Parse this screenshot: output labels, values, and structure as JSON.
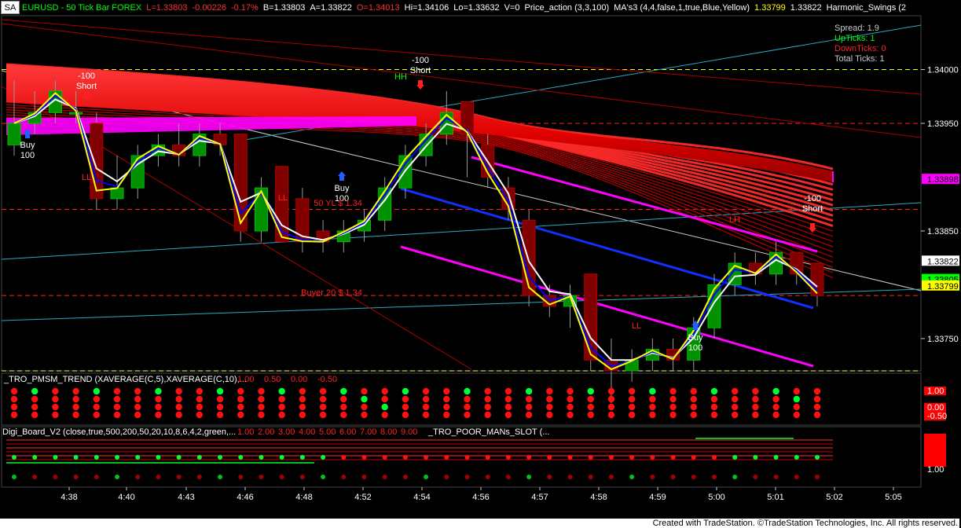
{
  "window": {
    "symbol_badge": "SA",
    "title_parts": [
      {
        "text": "EURUSD - 50 Tick Bar  FOREX",
        "color": "#00ff00"
      },
      {
        "text": "L=1.33803",
        "color": "#ff3030"
      },
      {
        "text": "-0.00226",
        "color": "#ff3030"
      },
      {
        "text": "-0.17%",
        "color": "#ff3030"
      },
      {
        "text": "B=1.33803",
        "color": "#ffffff"
      },
      {
        "text": "A=1.33822",
        "color": "#ffffff"
      },
      {
        "text": "O=1.34013",
        "color": "#ff3030"
      },
      {
        "text": "Hi=1.34106",
        "color": "#ffffff"
      },
      {
        "text": "Lo=1.33632",
        "color": "#ffffff"
      },
      {
        "text": "V=0",
        "color": "#ffffff"
      },
      {
        "text": "Price_action (3,3,100)",
        "color": "#ffffff"
      },
      {
        "text": "MA's3 (4,4,false,1,true,Blue,Yellow)",
        "color": "#ffffff"
      },
      {
        "text": "1.33799",
        "color": "#ffff00"
      },
      {
        "text": "1.33822",
        "color": "#ffffff"
      },
      {
        "text": "Harmonic_Swings (2",
        "color": "#ffffff"
      }
    ],
    "footer": "Created with TradeStation. ©TradeStation Technologies, Inc. All rights reserved."
  },
  "stats_box": [
    {
      "text": "Spread: 1.9",
      "color": "#cccccc"
    },
    {
      "text": "UpTicks: 1",
      "color": "#00ff00"
    },
    {
      "text": "DownTicks: 0",
      "color": "#ff2020"
    },
    {
      "text": "Total Ticks: 1",
      "color": "#cccccc"
    }
  ],
  "annotations": [
    {
      "id": "short1",
      "lines": [
        "-100",
        "Short"
      ],
      "color": "#ffffff"
    },
    {
      "id": "short2",
      "lines": [
        "-100",
        "Short"
      ],
      "color": "#ffffff"
    },
    {
      "id": "short3",
      "lines": [
        "-100",
        "Short"
      ],
      "color": "#ffffff"
    },
    {
      "id": "buy1",
      "lines": [
        "Buy",
        "100"
      ],
      "color": "#ffffff"
    },
    {
      "id": "buy2",
      "lines": [
        "Buy",
        "100"
      ],
      "color": "#ffffff"
    },
    {
      "id": "buy3",
      "lines": [
        "Buy",
        "100"
      ],
      "color": "#ffffff"
    },
    {
      "id": "hh",
      "lines": [
        "HH"
      ],
      "color": "#00ff00"
    },
    {
      "id": "ll1",
      "lines": [
        "LL"
      ],
      "color": "#ff2020"
    },
    {
      "id": "ll2",
      "lines": [
        "LL"
      ],
      "color": "#ff2020"
    },
    {
      "id": "ll3",
      "lines": [
        "LL"
      ],
      "color": "#ff2020"
    },
    {
      "id": "lh",
      "lines": [
        "LH"
      ],
      "color": "#ff2020"
    },
    {
      "id": "level50",
      "lines": [
        "50 YL $ 1.34"
      ],
      "color": "#ff2020"
    },
    {
      "id": "buyer20",
      "lines": [
        "Buyer 20 $ 1.34"
      ],
      "color": "#ff2020"
    }
  ],
  "price_axis": {
    "ticks": [
      "1.34000",
      "1.33950",
      "1.33850",
      "1.33750"
    ],
    "markers": [
      {
        "text": "1.33898",
        "bg": "#ff00ff",
        "fg": "#000000"
      },
      {
        "text": "1.33822",
        "bg": "#ffffff",
        "fg": "#000000"
      },
      {
        "text": "1.33805",
        "bg": "#00ff00",
        "fg": "#000000"
      },
      {
        "text": "1.33799",
        "bg": "#ffff00",
        "fg": "#000000"
      }
    ]
  },
  "chart_data": {
    "type": "candlestick",
    "title": "EURUSD - 50 Tick Bar FOREX",
    "x_tick_labels": [
      "4:38",
      "4:40",
      "4:43",
      "4:46",
      "4:48",
      "4:52",
      "4:54",
      "4:56",
      "4:57",
      "4:58",
      "4:59",
      "5:00",
      "5:01",
      "5:02",
      "5:05"
    ],
    "ylim": [
      1.3372,
      1.3405
    ],
    "y_ticks": [
      1.34,
      1.3395,
      1.3385,
      1.3375
    ],
    "candles": [
      {
        "o": 1.3393,
        "h": 1.3399,
        "l": 1.3392,
        "c": 1.3395
      },
      {
        "o": 1.3395,
        "h": 1.3398,
        "l": 1.3394,
        "c": 1.3396
      },
      {
        "o": 1.3396,
        "h": 1.3399,
        "l": 1.3395,
        "c": 1.3398
      },
      {
        "o": 1.3396,
        "h": 1.3398,
        "l": 1.3395,
        "c": 1.3396
      },
      {
        "o": 1.3395,
        "h": 1.3396,
        "l": 1.3387,
        "c": 1.3388
      },
      {
        "o": 1.3388,
        "h": 1.3392,
        "l": 1.3387,
        "c": 1.3389
      },
      {
        "o": 1.3389,
        "h": 1.3393,
        "l": 1.3388,
        "c": 1.3392
      },
      {
        "o": 1.3392,
        "h": 1.3394,
        "l": 1.3391,
        "c": 1.3393
      },
      {
        "o": 1.3393,
        "h": 1.3395,
        "l": 1.3391,
        "c": 1.3392
      },
      {
        "o": 1.3392,
        "h": 1.3395,
        "l": 1.3391,
        "c": 1.3394
      },
      {
        "o": 1.3394,
        "h": 1.3395,
        "l": 1.3392,
        "c": 1.3393
      },
      {
        "o": 1.3394,
        "h": 1.3394,
        "l": 1.3384,
        "c": 1.3385
      },
      {
        "o": 1.3385,
        "h": 1.339,
        "l": 1.3384,
        "c": 1.3389
      },
      {
        "o": 1.3391,
        "h": 1.3391,
        "l": 1.3384,
        "c": 1.3384
      },
      {
        "o": 1.3388,
        "h": 1.3389,
        "l": 1.3383,
        "c": 1.3384
      },
      {
        "o": 1.3385,
        "h": 1.3386,
        "l": 1.3383,
        "c": 1.3384
      },
      {
        "o": 1.3384,
        "h": 1.3386,
        "l": 1.3383,
        "c": 1.3385
      },
      {
        "o": 1.3385,
        "h": 1.3387,
        "l": 1.3384,
        "c": 1.3386
      },
      {
        "o": 1.3386,
        "h": 1.339,
        "l": 1.3385,
        "c": 1.3389
      },
      {
        "o": 1.3389,
        "h": 1.3393,
        "l": 1.3388,
        "c": 1.3392
      },
      {
        "o": 1.3392,
        "h": 1.3395,
        "l": 1.3391,
        "c": 1.3394
      },
      {
        "o": 1.3394,
        "h": 1.3398,
        "l": 1.3393,
        "c": 1.3396
      },
      {
        "o": 1.3397,
        "h": 1.3397,
        "l": 1.339,
        "c": 1.3394
      },
      {
        "o": 1.3393,
        "h": 1.3394,
        "l": 1.3389,
        "c": 1.339
      },
      {
        "o": 1.3389,
        "h": 1.339,
        "l": 1.3386,
        "c": 1.3387
      },
      {
        "o": 1.3386,
        "h": 1.3387,
        "l": 1.3378,
        "c": 1.3379
      },
      {
        "o": 1.3379,
        "h": 1.338,
        "l": 1.3377,
        "c": 1.3378
      },
      {
        "o": 1.3378,
        "h": 1.338,
        "l": 1.3376,
        "c": 1.3379
      },
      {
        "o": 1.3381,
        "h": 1.3381,
        "l": 1.3372,
        "c": 1.3373
      },
      {
        "o": 1.3373,
        "h": 1.3375,
        "l": 1.3369,
        "c": 1.3372
      },
      {
        "o": 1.3372,
        "h": 1.3374,
        "l": 1.3371,
        "c": 1.3373
      },
      {
        "o": 1.3373,
        "h": 1.3375,
        "l": 1.3372,
        "c": 1.3374
      },
      {
        "o": 1.3374,
        "h": 1.3375,
        "l": 1.3372,
        "c": 1.3373
      },
      {
        "o": 1.3373,
        "h": 1.3377,
        "l": 1.3372,
        "c": 1.3376
      },
      {
        "o": 1.3376,
        "h": 1.3381,
        "l": 1.3375,
        "c": 1.338
      },
      {
        "o": 1.338,
        "h": 1.3383,
        "l": 1.3379,
        "c": 1.3382
      },
      {
        "o": 1.3382,
        "h": 1.3383,
        "l": 1.338,
        "c": 1.3381
      },
      {
        "o": 1.3381,
        "h": 1.3384,
        "l": 1.338,
        "c": 1.3383
      },
      {
        "o": 1.3383,
        "h": 1.3383,
        "l": 1.338,
        "c": 1.3381
      },
      {
        "o": 1.3382,
        "h": 1.3382,
        "l": 1.3378,
        "c": 1.3379
      }
    ],
    "series": [
      {
        "name": "MA's3",
        "color": "#ffffff"
      },
      {
        "name": "MA's3",
        "color": "#0000ff"
      },
      {
        "name": "MA's3",
        "color": "#ffff00"
      }
    ]
  },
  "indicators": {
    "panel1": {
      "label": "_TRO_PMSM_TREND (XAVERAGE(C,5),XAVERAGE(C,10),...",
      "values": [
        {
          "text": "1.00",
          "color": "#ff2020"
        },
        {
          "text": "0.50",
          "color": "#ff2020"
        },
        {
          "text": "0.00",
          "color": "#ff2020"
        },
        {
          "text": "-0.50",
          "color": "#ff2020"
        }
      ],
      "axis": [
        {
          "text": "1.00",
          "bg": "#ff0000",
          "fg": "#ffffff"
        },
        {
          "text": "0.00",
          "bg": "#ff0000",
          "fg": "#ffffff"
        },
        {
          "text": "-0.50",
          "bg": "#ff0000",
          "fg": "#ffffff"
        }
      ]
    },
    "panel2": {
      "label": "Digi_Board_V2 (close,true,500,200,50,20,10,8,6,4,2,green,...",
      "values": [
        {
          "text": "1.00",
          "color": "#ff2020"
        },
        {
          "text": "2.00",
          "color": "#ff2020"
        },
        {
          "text": "3.00",
          "color": "#ff2020"
        },
        {
          "text": "4.00",
          "color": "#ff2020"
        },
        {
          "text": "5.00",
          "color": "#ff2020"
        },
        {
          "text": "6.00",
          "color": "#ff2020"
        },
        {
          "text": "7.00",
          "color": "#ff2020"
        },
        {
          "text": "8.00",
          "color": "#ff2020"
        },
        {
          "text": "9.00",
          "color": "#ff2020"
        }
      ],
      "label2": "_TRO_POOR_MANs_SLOT (...",
      "axis_bottom": "1.00"
    }
  }
}
